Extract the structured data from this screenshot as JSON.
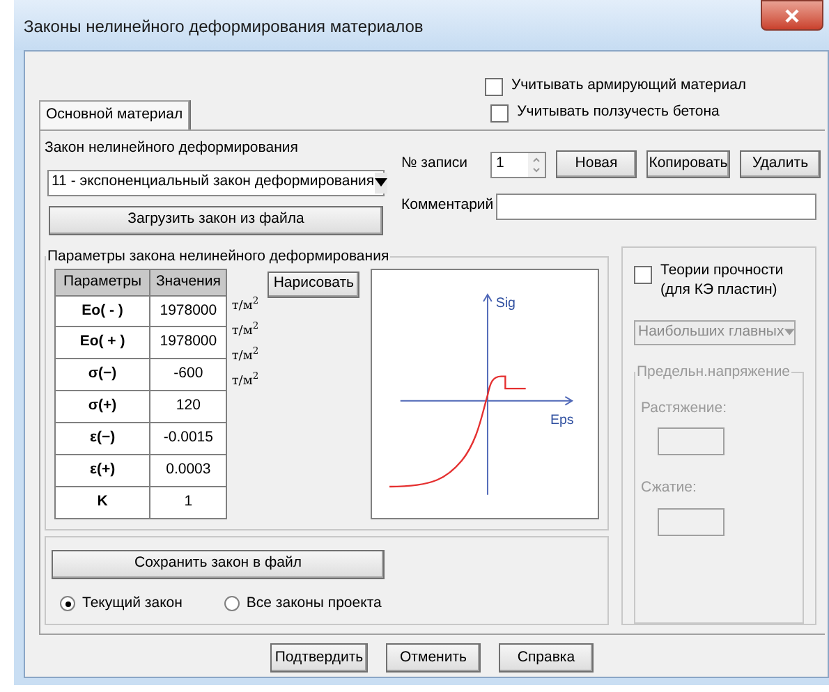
{
  "window": {
    "title": "Законы нелинейного деформирования материалов"
  },
  "options": [
    {
      "label": "Учитывать армирующий материал",
      "checked": false
    },
    {
      "label": "Учитывать ползучесть бетона",
      "checked": false
    }
  ],
  "tabs": [
    {
      "label": "Основной материал",
      "selected": true
    }
  ],
  "law": {
    "label": "Закон нелинейного деформирования",
    "value": "11 - экспоненциальный закон деформирования",
    "load_button": "Загрузить закон из файла"
  },
  "record": {
    "label": "№ записи",
    "value": "1",
    "buttons": [
      "Новая",
      "Копировать",
      "Удалить"
    ],
    "comment_label": "Комментарий"
  },
  "params": {
    "title": "Параметры закона нелинейного деформирования",
    "columns": [
      "Параметры",
      "Значения"
    ],
    "rows": [
      {
        "name": "Eo( - )",
        "value": "1978000",
        "unit": "т/м$^{2}$"
      },
      {
        "name": "Eo( + )",
        "value": "1978000",
        "unit": "т/м$^{2}$"
      },
      {
        "name": "σ(−)",
        "value": "-600",
        "unit": "т/м$^{2}$"
      },
      {
        "name": "σ(+)",
        "value": "120",
        "unit": "т/м$^{2}$"
      },
      {
        "name": "ε(−)",
        "value": "-0.0015"
      },
      {
        "name": "ε(+)",
        "value": "0.0003"
      },
      {
        "name": "K",
        "value": "1"
      }
    ],
    "draw_button": "Нарисовать",
    "graph": {
      "y_axis": "Sig",
      "x_axis": "Eps"
    }
  },
  "strength": {
    "label": "Теории прочности (для КЭ пластин)",
    "checked": false,
    "theory": "Наибольших главных",
    "limit_title": "Предельн.напряжение",
    "tension_label": "Растяжение:",
    "compression_label": "Сжатие:"
  },
  "save": {
    "button": "Сохранить закон в файл",
    "scope": [
      {
        "label": "Текущий закон",
        "selected": true
      },
      {
        "label": "Все законы проекта",
        "selected": false
      }
    ]
  },
  "buttons": [
    "Подтвердить",
    "Отменить",
    "Справка"
  ]
}
